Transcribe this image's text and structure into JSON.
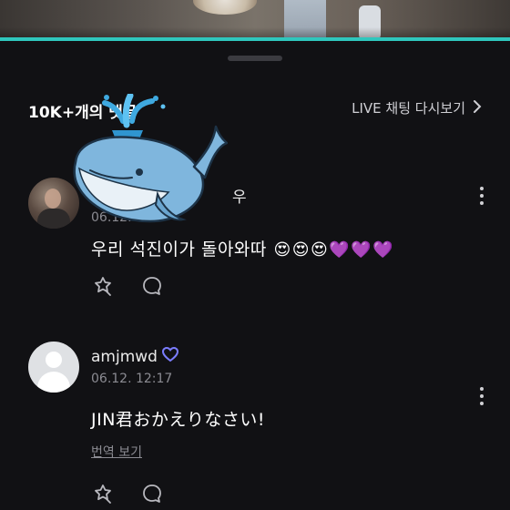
{
  "video": {
    "progress": 1.0,
    "accent": "#2fc7bd"
  },
  "header": {
    "title": "10K+개의 댓글",
    "replay_label": "LIVE 채팅 다시보기",
    "replay_icon": "chevron-right-icon"
  },
  "comments": [
    {
      "nickname": "",
      "nickname_suffix": "우",
      "timestamp": "06.12. 12:",
      "text": "우리 석진이가 돌아와따",
      "emojis": [
        "😍",
        "😍",
        "😍",
        "💜",
        "💜",
        "💜"
      ],
      "avatar": "profile-photo",
      "actions": [
        "sticker-reaction-icon",
        "reply-bubble-icon"
      ],
      "more_icon": "more-vertical-icon"
    },
    {
      "nickname": "amjmwd",
      "badge_icon": "purple-heart-badge-icon",
      "timestamp": "06.12. 12:17",
      "text": "JIN君おかえりなさい!",
      "translate_label": "번역 보기",
      "avatar": "default-avatar",
      "actions": [
        "sticker-reaction-icon",
        "reply-bubble-icon"
      ],
      "more_icon": "more-vertical-icon"
    }
  ],
  "overlay": {
    "sticker": "whale-sticker-icon"
  },
  "colors": {
    "background": "#111114",
    "muted": "#8b8b92",
    "badge": "#7b7dff"
  }
}
